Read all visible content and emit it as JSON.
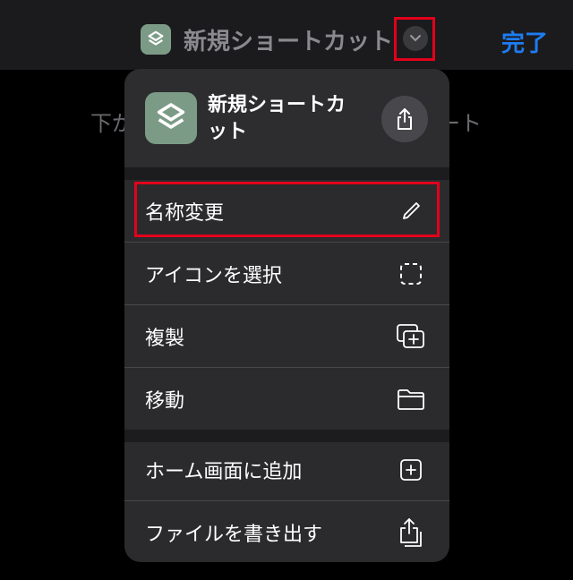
{
  "header": {
    "title": "新規ショートカット",
    "done_label": "完了"
  },
  "background": {
    "left_fragment": "下が",
    "right_fragment": "ート"
  },
  "menu": {
    "app_name": "新規ショートカット",
    "items": [
      {
        "label": "名称変更",
        "icon": "pencil-icon"
      },
      {
        "label": "アイコンを選択",
        "icon": "dashed-square-icon"
      },
      {
        "label": "複製",
        "icon": "duplicate-icon"
      },
      {
        "label": "移動",
        "icon": "folder-icon"
      },
      {
        "label": "ホーム画面に追加",
        "icon": "plus-square-icon"
      },
      {
        "label": "ファイルを書き出す",
        "icon": "export-icon"
      }
    ]
  },
  "colors": {
    "accent": "#1e7cf2",
    "highlight": "#e3001b",
    "app_icon_bg": "#7c9b86"
  }
}
